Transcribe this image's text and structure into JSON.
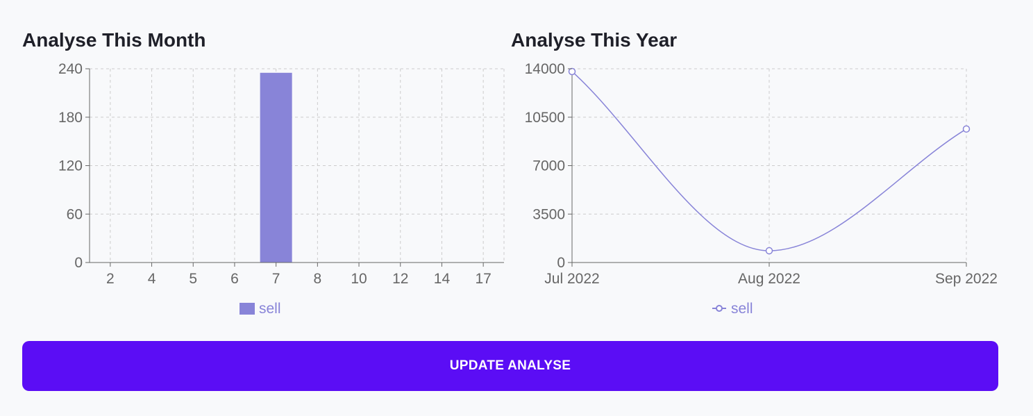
{
  "month_panel": {
    "title": "Analyse This Month"
  },
  "year_panel": {
    "title": "Analyse This Year"
  },
  "update_button": {
    "label": "UPDATE ANALYSE"
  },
  "colors": {
    "series": "#8884d8",
    "button": "#5b0df5",
    "grid": "#cccccc",
    "axis": "#666666"
  },
  "chart_data": [
    {
      "type": "bar",
      "title": "Analyse This Month",
      "categories": [
        "2",
        "4",
        "5",
        "6",
        "7",
        "8",
        "10",
        "12",
        "14",
        "17"
      ],
      "series": [
        {
          "name": "sell",
          "values": [
            0,
            0,
            0,
            0,
            235,
            0,
            0,
            0,
            0,
            0
          ]
        }
      ],
      "ylim": [
        0,
        240
      ],
      "yticks": [
        0,
        60,
        120,
        180,
        240
      ],
      "grid": true,
      "legend": "bottom-center"
    },
    {
      "type": "line",
      "title": "Analyse This Year",
      "categories": [
        "Jul 2022",
        "Aug 2022",
        "Sep 2022"
      ],
      "series": [
        {
          "name": "sell",
          "values": [
            13800,
            850,
            9650
          ]
        }
      ],
      "ylim": [
        0,
        14000
      ],
      "yticks": [
        0,
        3500,
        7000,
        10500,
        14000
      ],
      "grid": true,
      "legend": "bottom-center"
    }
  ]
}
